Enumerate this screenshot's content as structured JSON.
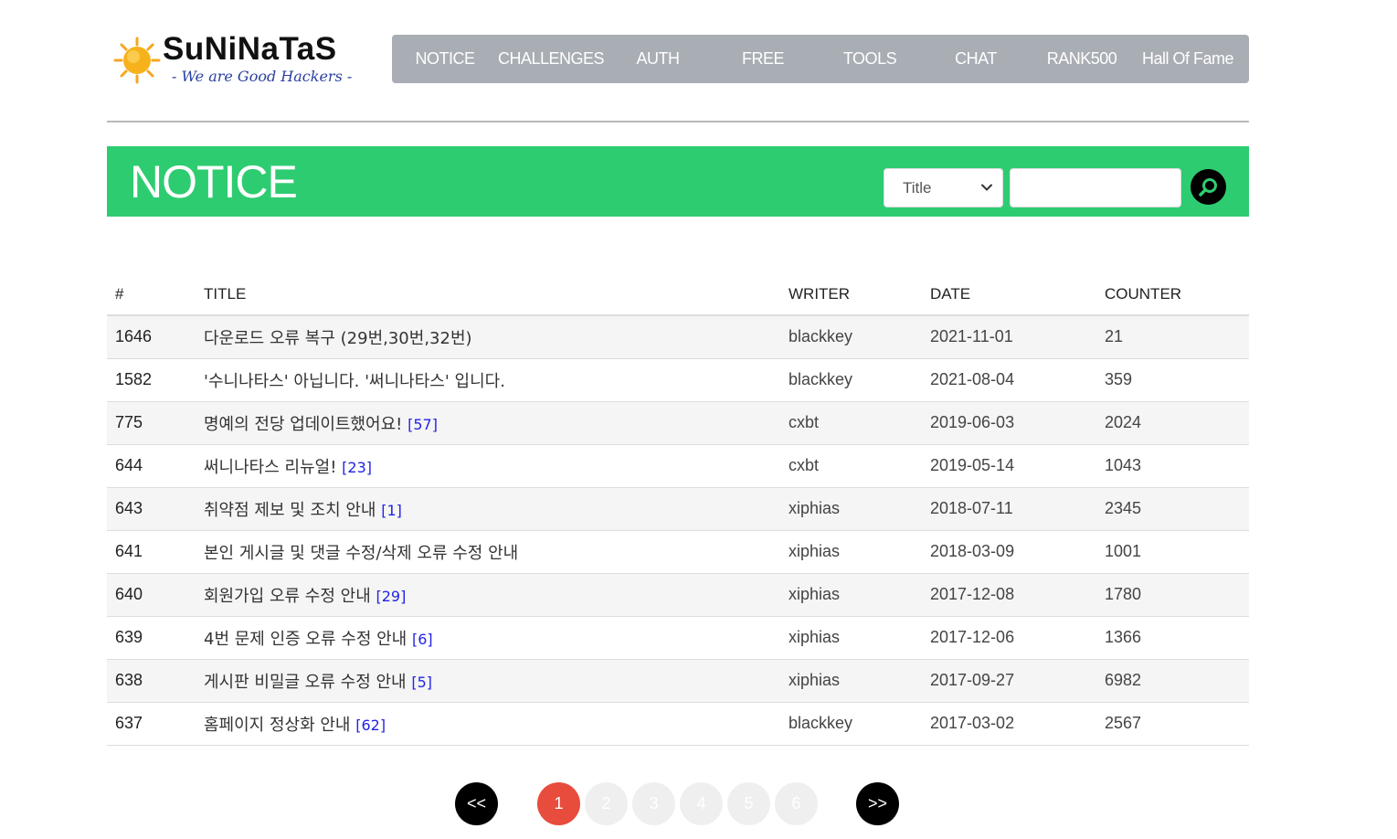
{
  "logo": {
    "title": "SuNiNaTaS",
    "subtitle": "- We are Good Hackers -"
  },
  "nav": [
    {
      "label": "NOTICE"
    },
    {
      "label": "CHALLENGES"
    },
    {
      "label": "AUTH"
    },
    {
      "label": "FREE"
    },
    {
      "label": "TOOLS"
    },
    {
      "label": "CHAT"
    },
    {
      "label": "RANK500"
    },
    {
      "label": "Hall Of Fame"
    }
  ],
  "banner": {
    "title": "NOTICE"
  },
  "search": {
    "selected": "Title",
    "value": ""
  },
  "table": {
    "headers": {
      "num": "#",
      "title": "TITLE",
      "writer": "WRITER",
      "date": "DATE",
      "counter": "COUNTER"
    },
    "rows": [
      {
        "num": "1646",
        "title": "다운로드 오류 복구 (29번,30번,32번)",
        "comments": "",
        "writer": "blackkey",
        "date": "2021-11-01",
        "counter": "21"
      },
      {
        "num": "1582",
        "title": "'수니나타스' 아닙니다. '써니나타스' 입니다.",
        "comments": "",
        "writer": "blackkey",
        "date": "2021-08-04",
        "counter": "359"
      },
      {
        "num": "775",
        "title": "명예의 전당 업데이트했어요!",
        "comments": "[57]",
        "writer": "cxbt",
        "date": "2019-06-03",
        "counter": "2024"
      },
      {
        "num": "644",
        "title": "써니나타스 리뉴얼!",
        "comments": "[23]",
        "writer": "cxbt",
        "date": "2019-05-14",
        "counter": "1043"
      },
      {
        "num": "643",
        "title": "취약점 제보 및 조치 안내",
        "comments": "[1]",
        "writer": "xiphias",
        "date": "2018-07-11",
        "counter": "2345"
      },
      {
        "num": "641",
        "title": "본인 게시글 및 댓글 수정/삭제 오류 수정 안내",
        "comments": "",
        "writer": "xiphias",
        "date": "2018-03-09",
        "counter": "1001"
      },
      {
        "num": "640",
        "title": "회원가입 오류 수정 안내",
        "comments": "[29]",
        "writer": "xiphias",
        "date": "2017-12-08",
        "counter": "1780"
      },
      {
        "num": "639",
        "title": "4번 문제 인증 오류 수정 안내",
        "comments": "[6]",
        "writer": "xiphias",
        "date": "2017-12-06",
        "counter": "1366"
      },
      {
        "num": "638",
        "title": "게시판 비밀글 오류 수정 안내",
        "comments": "[5]",
        "writer": "xiphias",
        "date": "2017-09-27",
        "counter": "6982"
      },
      {
        "num": "637",
        "title": "홈페이지 정상화 안내",
        "comments": "[62]",
        "writer": "blackkey",
        "date": "2017-03-02",
        "counter": "2567"
      }
    ]
  },
  "pagination": {
    "prev": "<<",
    "next": ">>",
    "pages": [
      "1",
      "2",
      "3",
      "4",
      "5",
      "6"
    ],
    "active": "1"
  },
  "colors": {
    "banner": "#2ecc71",
    "nav": "#a9adb4",
    "active_page": "#e74c3c",
    "comment_count": "#2323e6"
  }
}
